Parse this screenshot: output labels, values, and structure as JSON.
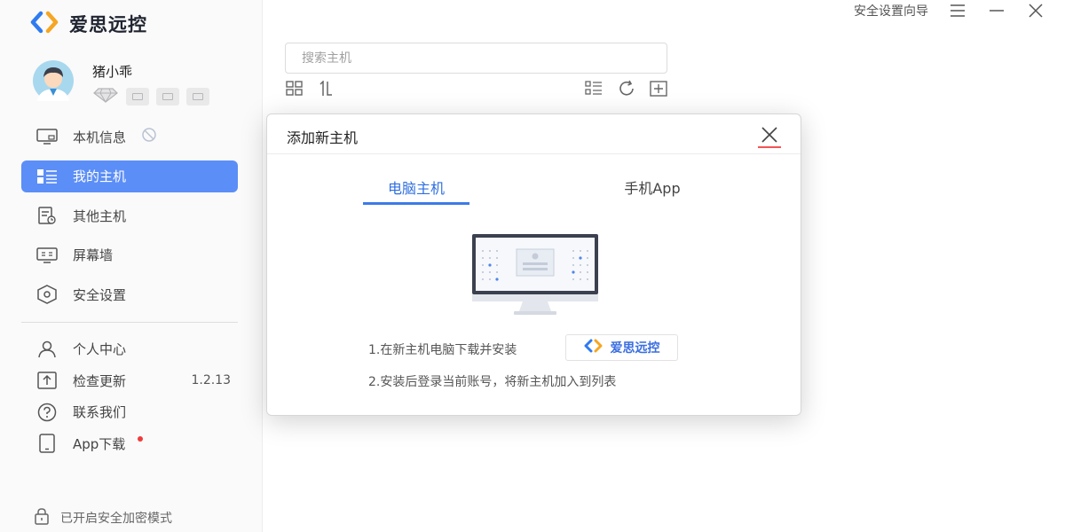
{
  "app": {
    "name": "爱思远控",
    "logo_icon": "aisi-logo-icon"
  },
  "user": {
    "name": "猪小乖",
    "badges": [
      "diamond-icon",
      "card-icon",
      "device-icon",
      "list-icon"
    ]
  },
  "sidebar": {
    "items": [
      {
        "label": "本机信息",
        "icon": "monitor-icon",
        "extra_icon": "hidden-status-icon"
      },
      {
        "label": "我的主机",
        "icon": "my-hosts-icon",
        "active": true
      },
      {
        "label": "其他主机",
        "icon": "other-hosts-icon"
      },
      {
        "label": "屏幕墙",
        "icon": "screen-wall-icon"
      },
      {
        "label": "安全设置",
        "icon": "security-icon"
      }
    ],
    "bottom_items": [
      {
        "label": "个人中心",
        "icon": "person-icon"
      },
      {
        "label": "检查更新",
        "icon": "update-icon",
        "value": "1.2.13"
      },
      {
        "label": "联系我们",
        "icon": "help-icon"
      },
      {
        "label": "App下载",
        "icon": "phone-icon",
        "dot": true
      }
    ],
    "secure_mode": "已开启安全加密模式"
  },
  "topbar": {
    "wizard": "安全设置向导"
  },
  "search": {
    "placeholder": "搜索主机",
    "value": ""
  },
  "modal": {
    "title": "添加新主机",
    "tabs": [
      {
        "label": "电脑主机",
        "active": true
      },
      {
        "label": "手机App",
        "active": false
      }
    ],
    "step1": "1.在新主机电脑下载并安装",
    "badge_label": "爱思远控",
    "step2": "2.安装后登录当前账号，将新主机加入到列表"
  },
  "colors": {
    "accent": "#5b8ef7",
    "tab_active": "#2f6fe0",
    "close_underline": "#f25555",
    "dot": "#f03a3a"
  }
}
